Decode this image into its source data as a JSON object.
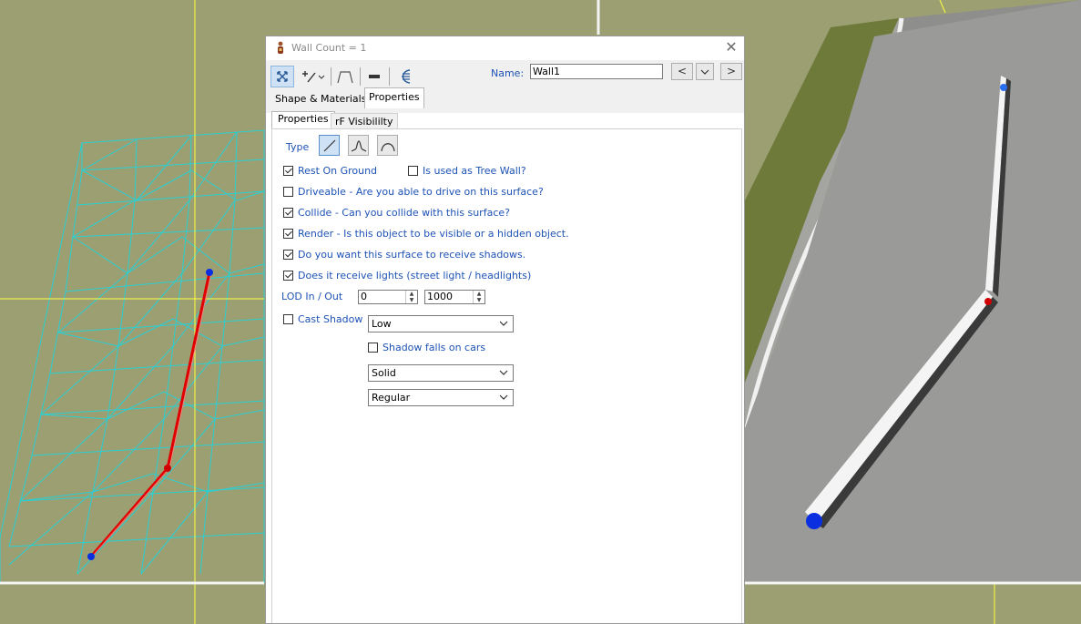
{
  "window": {
    "title": "Wall Count = 1",
    "close_symbol": "✕"
  },
  "toolbar": {
    "buttons": [
      {
        "icon": "move-arrows-icon",
        "active": true
      },
      {
        "icon": "add-point-dropdown-icon",
        "active": false
      },
      {
        "icon": "spline-shape-icon",
        "active": false
      },
      {
        "icon": "minus-icon",
        "active": false
      },
      {
        "icon": "comb-icon",
        "active": false
      }
    ],
    "name_label": "Name:",
    "name_value": "Wall1",
    "prev_label": "<",
    "dropdown_label": "⌄",
    "next_label": ">"
  },
  "tabs": [
    "Shape & Materials",
    "Properties"
  ],
  "selected_tab": "Properties",
  "inner_tabs": [
    "Properties",
    "rF Visibililty"
  ],
  "selected_inner_tab": "Properties",
  "properties": {
    "type_label": "Type",
    "type_options": [
      {
        "icon": "straight-line-icon",
        "active": true
      },
      {
        "icon": "peak-curve-icon",
        "active": false
      },
      {
        "icon": "arch-curve-icon",
        "active": false
      }
    ],
    "rest_on_ground": {
      "label": "Rest On Ground",
      "checked": true
    },
    "tree_wall": {
      "label": "Is used as Tree Wall?",
      "checked": false
    },
    "driveable": {
      "label": "Driveable - Are you able to drive on this surface?",
      "checked": false
    },
    "collide": {
      "label": "Collide - Can you collide with this surface?",
      "checked": true
    },
    "render": {
      "label": "Render - Is this object to be visible or a hidden object.",
      "checked": true
    },
    "receive_shadows": {
      "label": "Do you want this surface to receive shadows.",
      "checked": true
    },
    "receive_lights": {
      "label": "Does it receive lights (street light / headlights)",
      "checked": true
    },
    "lod_label": "LOD In / Out",
    "lod_in": "0",
    "lod_out": "1000",
    "cast_shadow": {
      "label": "Cast Shadow",
      "checked": false
    },
    "cast_shadow_level": "Low",
    "shadow_falls_on_cars": {
      "label": "Shadow falls on cars",
      "checked": false
    },
    "shadow_type": "Solid",
    "shadow_mode": "Regular"
  },
  "colors": {
    "label_blue": "#1e53b6",
    "grass": "#9c9f72",
    "mesh": "#2ad0d4",
    "wall_line": "#e00000",
    "point": "#0a2fe0",
    "axis": "#ffff40"
  }
}
